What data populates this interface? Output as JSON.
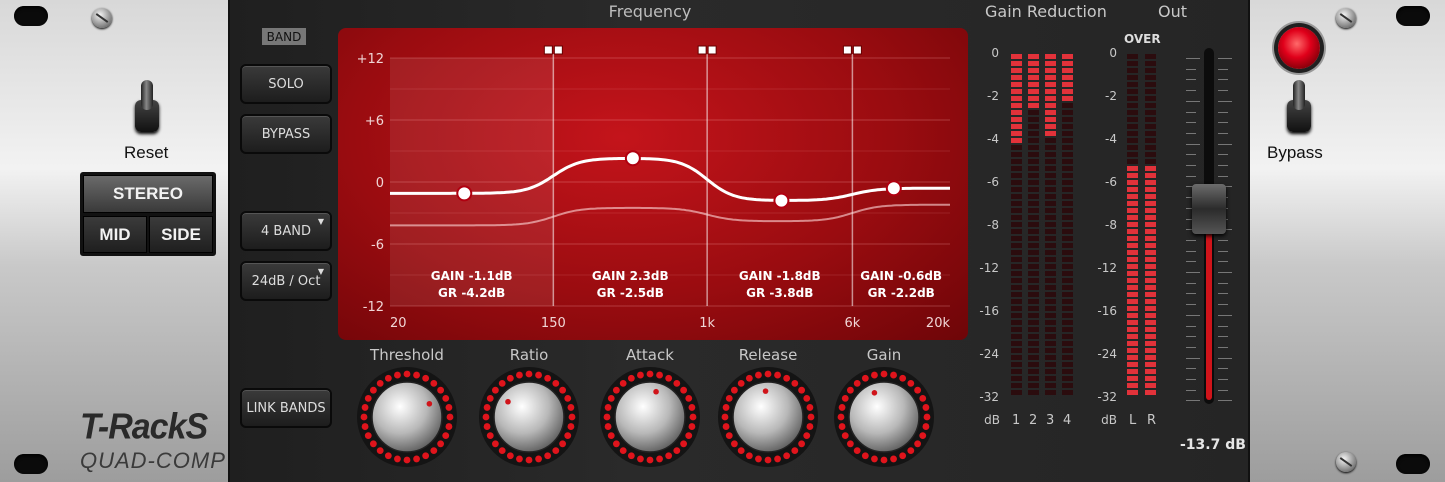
{
  "left_ear": {
    "reset_label": "Reset",
    "mode": {
      "stereo": "STEREO",
      "mid": "MID",
      "side": "SIDE",
      "selected": "STEREO"
    },
    "logo": {
      "line1": "T-RackS",
      "line2": "QUAD-COMP"
    }
  },
  "right_ear": {
    "bypass_label": "Bypass",
    "bypass_led_color": "#e0001a"
  },
  "controls": {
    "band_tag": "BAND",
    "solo": "SOLO",
    "bypass": "BYPASS",
    "band_count": "4 BAND",
    "slope": "24dB / Oct",
    "link_bands": "LINK BANDS"
  },
  "graph": {
    "title": "Frequency",
    "y_ticks": [
      "+12",
      "+6",
      "0",
      "-6",
      "-12"
    ],
    "y_values": [
      12,
      6,
      0,
      -6,
      -12
    ],
    "x_ticks": [
      "20",
      "150",
      "1k",
      "6k",
      "20k"
    ],
    "x_values": [
      20,
      150,
      1000,
      6000,
      20000
    ],
    "crossovers_hz": [
      150,
      1000,
      6000
    ],
    "bands": [
      {
        "gain_label": "GAIN -1.1dB",
        "gr_label": "GR -4.2dB",
        "gain": -1.1,
        "gr": -4.2,
        "node_hz": 50
      },
      {
        "gain_label": "GAIN 2.3dB",
        "gr_label": "GR -2.5dB",
        "gain": 2.3,
        "gr": -2.5,
        "node_hz": 400
      },
      {
        "gain_label": "GAIN -1.8dB",
        "gr_label": "GR -3.8dB",
        "gain": -1.8,
        "gr": -3.8,
        "node_hz": 2500
      },
      {
        "gain_label": "GAIN -0.6dB",
        "gr_label": "GR -2.2dB",
        "gain": -0.6,
        "gr": -2.2,
        "node_hz": 10000
      }
    ],
    "accent": "#c4141b"
  },
  "knobs": [
    {
      "label": "Threshold",
      "value": 0.72
    },
    {
      "label": "Ratio",
      "value": 0.3
    },
    {
      "label": "Attack",
      "value": 0.55
    },
    {
      "label": "Release",
      "value": 0.48
    },
    {
      "label": "Gain",
      "value": 0.42
    }
  ],
  "gain_reduction": {
    "title": "Gain Reduction",
    "scale": [
      "0",
      "-2",
      "-4",
      "-6",
      "-8",
      "-12",
      "-16",
      "-24",
      "-32"
    ],
    "unit": "dB",
    "channels": [
      "1",
      "2",
      "3",
      "4"
    ],
    "levels_db": [
      -4.2,
      -2.5,
      -3.8,
      -2.2
    ]
  },
  "output": {
    "title": "Out",
    "over_label": "OVER",
    "scale": [
      "0",
      "-2",
      "-4",
      "-6",
      "-8",
      "-12",
      "-16",
      "-24",
      "-32"
    ],
    "unit": "dB",
    "channels": [
      "L",
      "R"
    ],
    "levels_db": [
      -5.2,
      -5.2
    ],
    "fader_value": "-13.7 dB",
    "fader_fraction": 0.55
  }
}
